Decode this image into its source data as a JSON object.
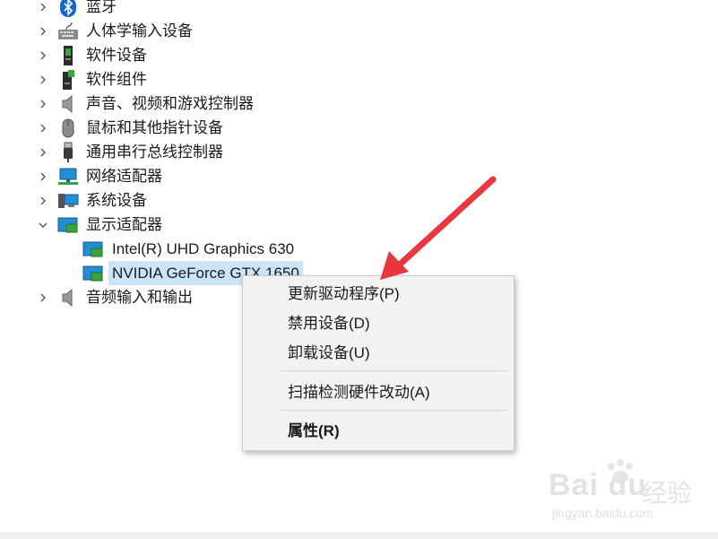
{
  "tree": {
    "items": [
      {
        "label": "蓝牙",
        "icon": "bluetooth-icon"
      },
      {
        "label": "人体学输入设备",
        "icon": "keyboard-icon"
      },
      {
        "label": "软件设备",
        "icon": "software-device-icon"
      },
      {
        "label": "软件组件",
        "icon": "software-component-icon"
      },
      {
        "label": "声音、视频和游戏控制器",
        "icon": "speaker-icon"
      },
      {
        "label": "鼠标和其他指针设备",
        "icon": "mouse-icon"
      },
      {
        "label": "通用串行总线控制器",
        "icon": "usb-icon"
      },
      {
        "label": "网络适配器",
        "icon": "network-icon"
      },
      {
        "label": "系统设备",
        "icon": "system-device-icon"
      },
      {
        "label": "显示适配器",
        "icon": "display-adapter-icon",
        "expanded": true
      },
      {
        "label": "音频输入和输出",
        "icon": "audio-icon"
      }
    ],
    "display_children": [
      {
        "label": "Intel(R) UHD Graphics 630",
        "icon": "gpu-icon"
      },
      {
        "label": "NVIDIA GeForce GTX 1650",
        "icon": "gpu-icon",
        "selected": true
      }
    ]
  },
  "context_menu": {
    "items": [
      {
        "label": "更新驱动程序(P)"
      },
      {
        "label": "禁用设备(D)"
      },
      {
        "label": "卸载设备(U)"
      },
      {
        "label": "扫描检测硬件改动(A)"
      },
      {
        "label": "属性(R)",
        "bold": true
      }
    ]
  },
  "watermark": {
    "logo": "Bai du",
    "name": "经验",
    "url": "jingyan.baidu.com"
  },
  "colors": {
    "selection": "#cce4f7",
    "arrow": "#e8383d",
    "menu_bg": "#f2f2f2"
  }
}
